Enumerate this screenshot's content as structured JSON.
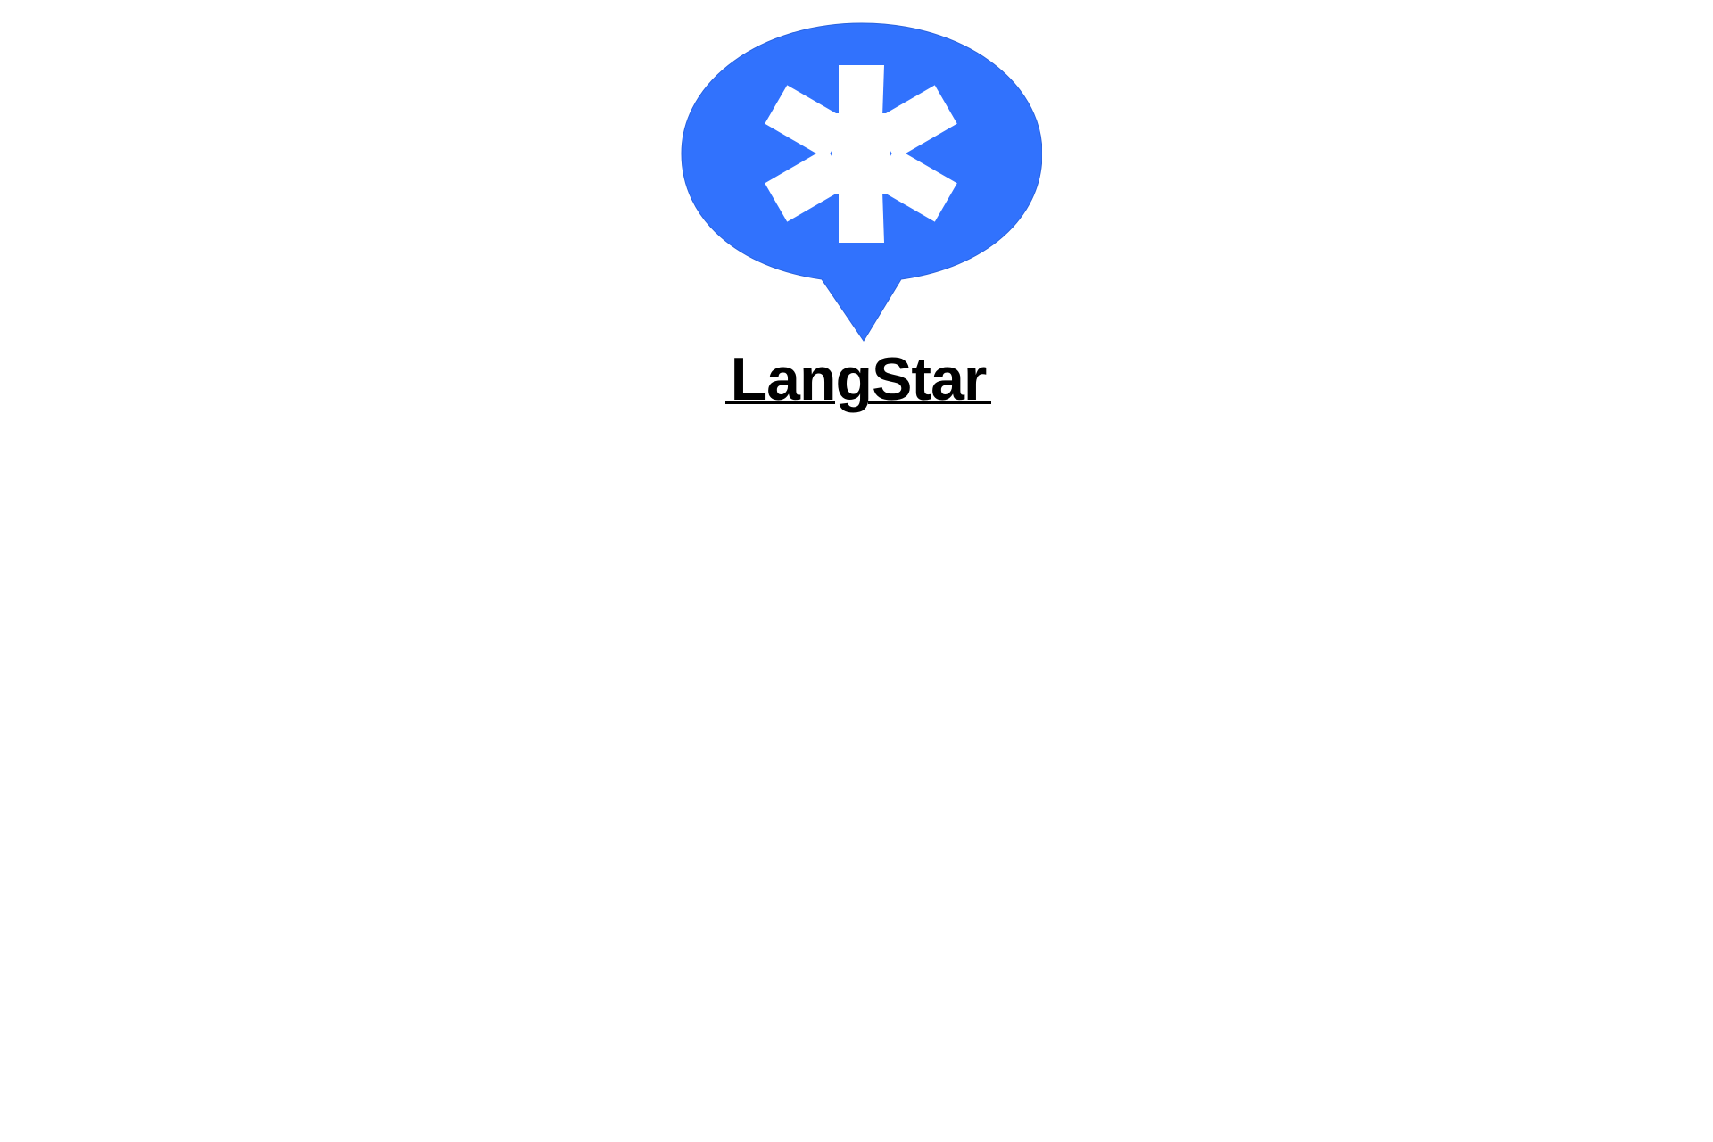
{
  "logo": {
    "name": "LangStar",
    "icon": "asterisk-speech-bubble-icon",
    "brand_color": "#3172FD",
    "icon_color": "#FFFFFF",
    "text_color": "#000000"
  }
}
